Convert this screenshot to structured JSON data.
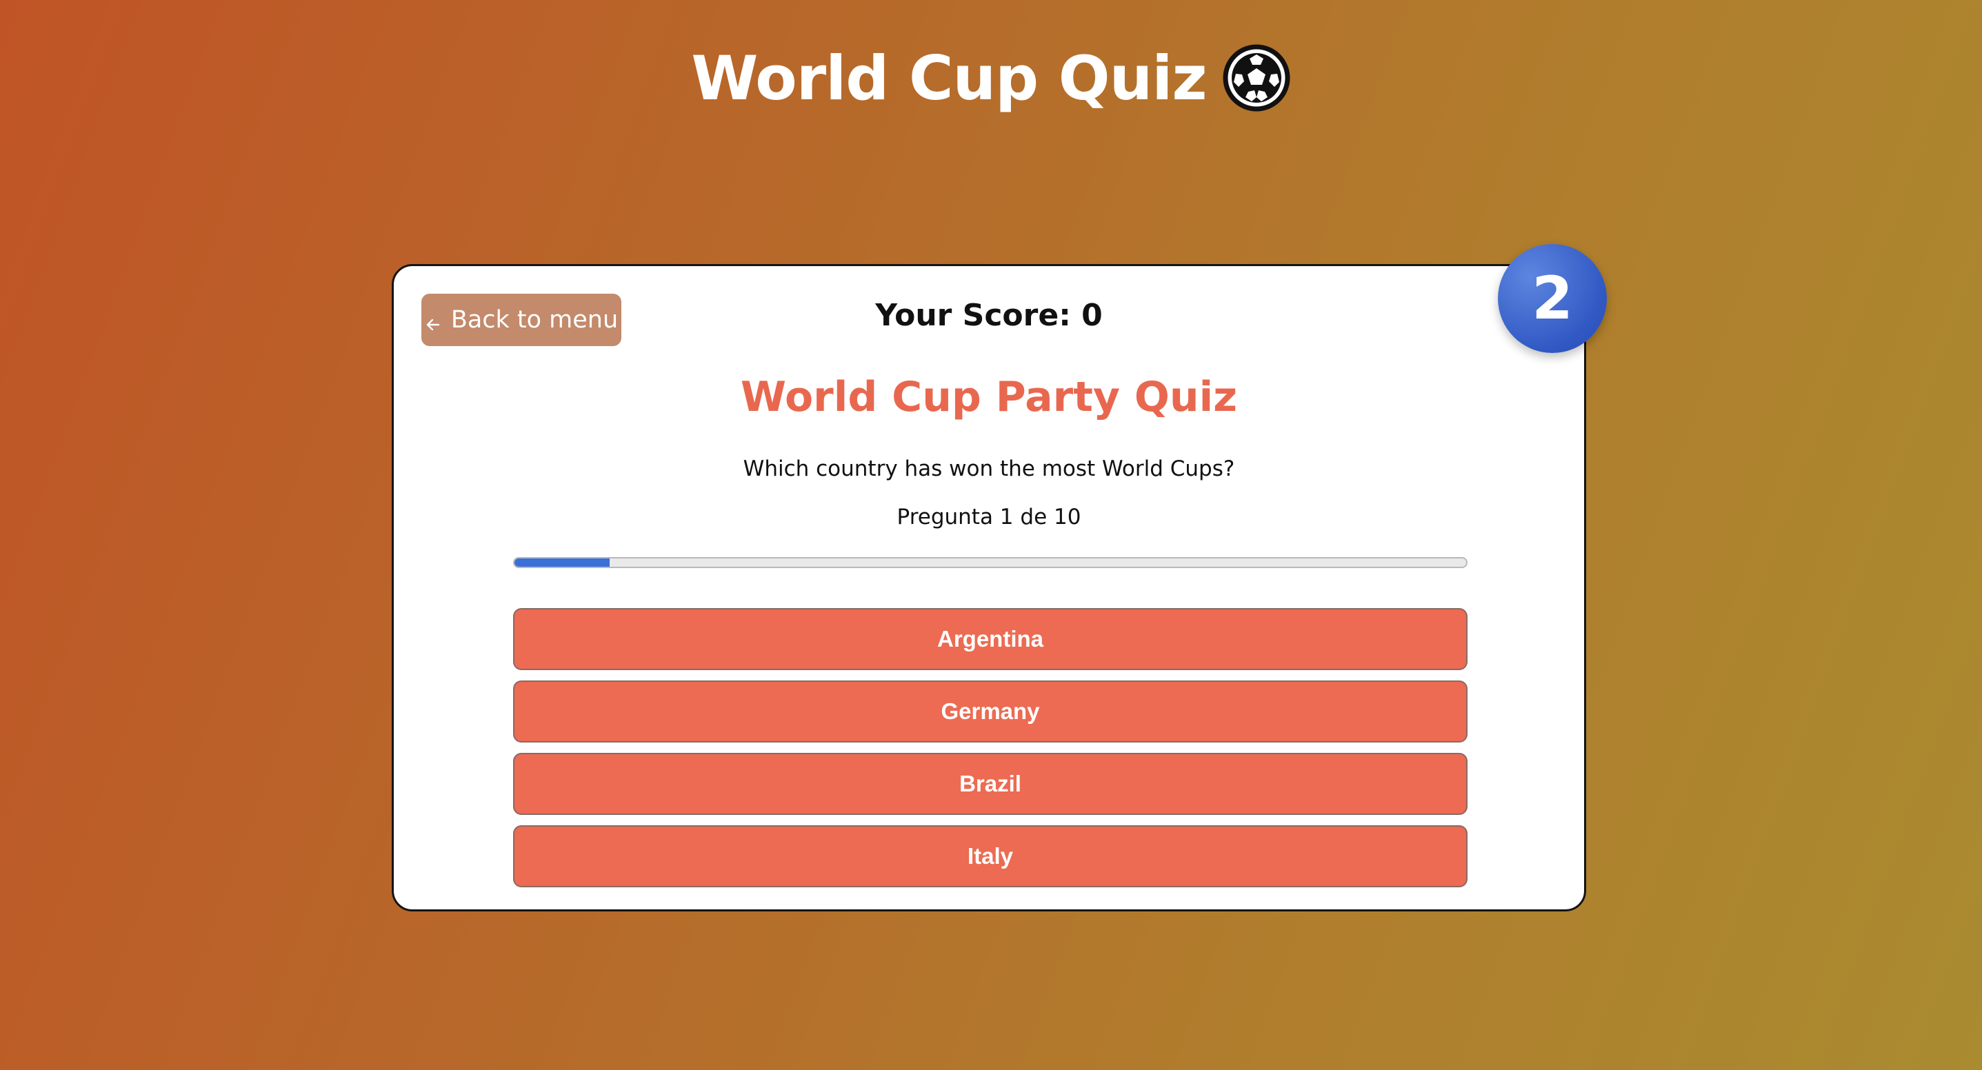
{
  "header": {
    "title": "World Cup Quiz",
    "icon": "soccer-ball-icon"
  },
  "card": {
    "back_label": "Back to menu",
    "back_icon": "arrow-left-icon",
    "score_label": "Your Score: 0",
    "step_badge": "2",
    "quiz_title": "World Cup Party Quiz",
    "question": "Which country has won the most World Cups?",
    "counter": "Pregunta 1 de 10",
    "progress_fraction": 0.1,
    "answers": [
      "Argentina",
      "Germany",
      "Brazil",
      "Italy"
    ]
  },
  "colors": {
    "accent": "#ec6b52",
    "title": "#e8684f",
    "progress": "#3a6fd8",
    "badge": "#3a63cc",
    "back_button": "#c38a6b"
  }
}
